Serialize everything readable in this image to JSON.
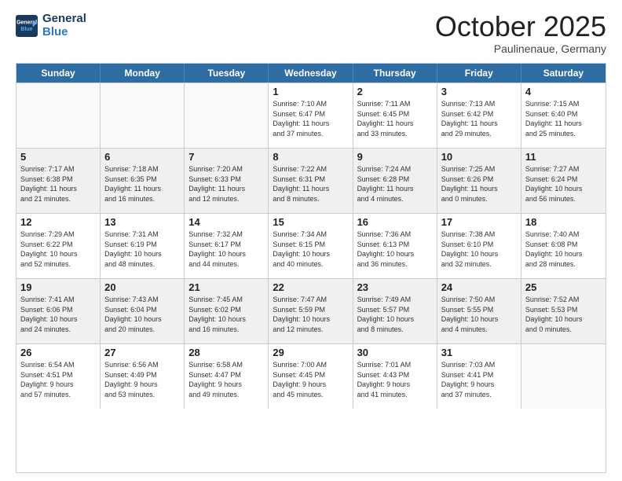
{
  "header": {
    "logo_general": "General",
    "logo_blue": "Blue",
    "month_title": "October 2025",
    "location": "Paulinenaue, Germany"
  },
  "days_of_week": [
    "Sunday",
    "Monday",
    "Tuesday",
    "Wednesday",
    "Thursday",
    "Friday",
    "Saturday"
  ],
  "rows": [
    [
      {
        "day": "",
        "info": [],
        "empty": true
      },
      {
        "day": "",
        "info": [],
        "empty": true
      },
      {
        "day": "",
        "info": [],
        "empty": true
      },
      {
        "day": "1",
        "info": [
          "Sunrise: 7:10 AM",
          "Sunset: 6:47 PM",
          "Daylight: 11 hours",
          "and 37 minutes."
        ],
        "empty": false
      },
      {
        "day": "2",
        "info": [
          "Sunrise: 7:11 AM",
          "Sunset: 6:45 PM",
          "Daylight: 11 hours",
          "and 33 minutes."
        ],
        "empty": false
      },
      {
        "day": "3",
        "info": [
          "Sunrise: 7:13 AM",
          "Sunset: 6:42 PM",
          "Daylight: 11 hours",
          "and 29 minutes."
        ],
        "empty": false
      },
      {
        "day": "4",
        "info": [
          "Sunrise: 7:15 AM",
          "Sunset: 6:40 PM",
          "Daylight: 11 hours",
          "and 25 minutes."
        ],
        "empty": false
      }
    ],
    [
      {
        "day": "5",
        "info": [
          "Sunrise: 7:17 AM",
          "Sunset: 6:38 PM",
          "Daylight: 11 hours",
          "and 21 minutes."
        ],
        "empty": false
      },
      {
        "day": "6",
        "info": [
          "Sunrise: 7:18 AM",
          "Sunset: 6:35 PM",
          "Daylight: 11 hours",
          "and 16 minutes."
        ],
        "empty": false
      },
      {
        "day": "7",
        "info": [
          "Sunrise: 7:20 AM",
          "Sunset: 6:33 PM",
          "Daylight: 11 hours",
          "and 12 minutes."
        ],
        "empty": false
      },
      {
        "day": "8",
        "info": [
          "Sunrise: 7:22 AM",
          "Sunset: 6:31 PM",
          "Daylight: 11 hours",
          "and 8 minutes."
        ],
        "empty": false
      },
      {
        "day": "9",
        "info": [
          "Sunrise: 7:24 AM",
          "Sunset: 6:28 PM",
          "Daylight: 11 hours",
          "and 4 minutes."
        ],
        "empty": false
      },
      {
        "day": "10",
        "info": [
          "Sunrise: 7:25 AM",
          "Sunset: 6:26 PM",
          "Daylight: 11 hours",
          "and 0 minutes."
        ],
        "empty": false
      },
      {
        "day": "11",
        "info": [
          "Sunrise: 7:27 AM",
          "Sunset: 6:24 PM",
          "Daylight: 10 hours",
          "and 56 minutes."
        ],
        "empty": false
      }
    ],
    [
      {
        "day": "12",
        "info": [
          "Sunrise: 7:29 AM",
          "Sunset: 6:22 PM",
          "Daylight: 10 hours",
          "and 52 minutes."
        ],
        "empty": false
      },
      {
        "day": "13",
        "info": [
          "Sunrise: 7:31 AM",
          "Sunset: 6:19 PM",
          "Daylight: 10 hours",
          "and 48 minutes."
        ],
        "empty": false
      },
      {
        "day": "14",
        "info": [
          "Sunrise: 7:32 AM",
          "Sunset: 6:17 PM",
          "Daylight: 10 hours",
          "and 44 minutes."
        ],
        "empty": false
      },
      {
        "day": "15",
        "info": [
          "Sunrise: 7:34 AM",
          "Sunset: 6:15 PM",
          "Daylight: 10 hours",
          "and 40 minutes."
        ],
        "empty": false
      },
      {
        "day": "16",
        "info": [
          "Sunrise: 7:36 AM",
          "Sunset: 6:13 PM",
          "Daylight: 10 hours",
          "and 36 minutes."
        ],
        "empty": false
      },
      {
        "day": "17",
        "info": [
          "Sunrise: 7:38 AM",
          "Sunset: 6:10 PM",
          "Daylight: 10 hours",
          "and 32 minutes."
        ],
        "empty": false
      },
      {
        "day": "18",
        "info": [
          "Sunrise: 7:40 AM",
          "Sunset: 6:08 PM",
          "Daylight: 10 hours",
          "and 28 minutes."
        ],
        "empty": false
      }
    ],
    [
      {
        "day": "19",
        "info": [
          "Sunrise: 7:41 AM",
          "Sunset: 6:06 PM",
          "Daylight: 10 hours",
          "and 24 minutes."
        ],
        "empty": false
      },
      {
        "day": "20",
        "info": [
          "Sunrise: 7:43 AM",
          "Sunset: 6:04 PM",
          "Daylight: 10 hours",
          "and 20 minutes."
        ],
        "empty": false
      },
      {
        "day": "21",
        "info": [
          "Sunrise: 7:45 AM",
          "Sunset: 6:02 PM",
          "Daylight: 10 hours",
          "and 16 minutes."
        ],
        "empty": false
      },
      {
        "day": "22",
        "info": [
          "Sunrise: 7:47 AM",
          "Sunset: 5:59 PM",
          "Daylight: 10 hours",
          "and 12 minutes."
        ],
        "empty": false
      },
      {
        "day": "23",
        "info": [
          "Sunrise: 7:49 AM",
          "Sunset: 5:57 PM",
          "Daylight: 10 hours",
          "and 8 minutes."
        ],
        "empty": false
      },
      {
        "day": "24",
        "info": [
          "Sunrise: 7:50 AM",
          "Sunset: 5:55 PM",
          "Daylight: 10 hours",
          "and 4 minutes."
        ],
        "empty": false
      },
      {
        "day": "25",
        "info": [
          "Sunrise: 7:52 AM",
          "Sunset: 5:53 PM",
          "Daylight: 10 hours",
          "and 0 minutes."
        ],
        "empty": false
      }
    ],
    [
      {
        "day": "26",
        "info": [
          "Sunrise: 6:54 AM",
          "Sunset: 4:51 PM",
          "Daylight: 9 hours",
          "and 57 minutes."
        ],
        "empty": false
      },
      {
        "day": "27",
        "info": [
          "Sunrise: 6:56 AM",
          "Sunset: 4:49 PM",
          "Daylight: 9 hours",
          "and 53 minutes."
        ],
        "empty": false
      },
      {
        "day": "28",
        "info": [
          "Sunrise: 6:58 AM",
          "Sunset: 4:47 PM",
          "Daylight: 9 hours",
          "and 49 minutes."
        ],
        "empty": false
      },
      {
        "day": "29",
        "info": [
          "Sunrise: 7:00 AM",
          "Sunset: 4:45 PM",
          "Daylight: 9 hours",
          "and 45 minutes."
        ],
        "empty": false
      },
      {
        "day": "30",
        "info": [
          "Sunrise: 7:01 AM",
          "Sunset: 4:43 PM",
          "Daylight: 9 hours",
          "and 41 minutes."
        ],
        "empty": false
      },
      {
        "day": "31",
        "info": [
          "Sunrise: 7:03 AM",
          "Sunset: 4:41 PM",
          "Daylight: 9 hours",
          "and 37 minutes."
        ],
        "empty": false
      },
      {
        "day": "",
        "info": [],
        "empty": true
      }
    ]
  ]
}
